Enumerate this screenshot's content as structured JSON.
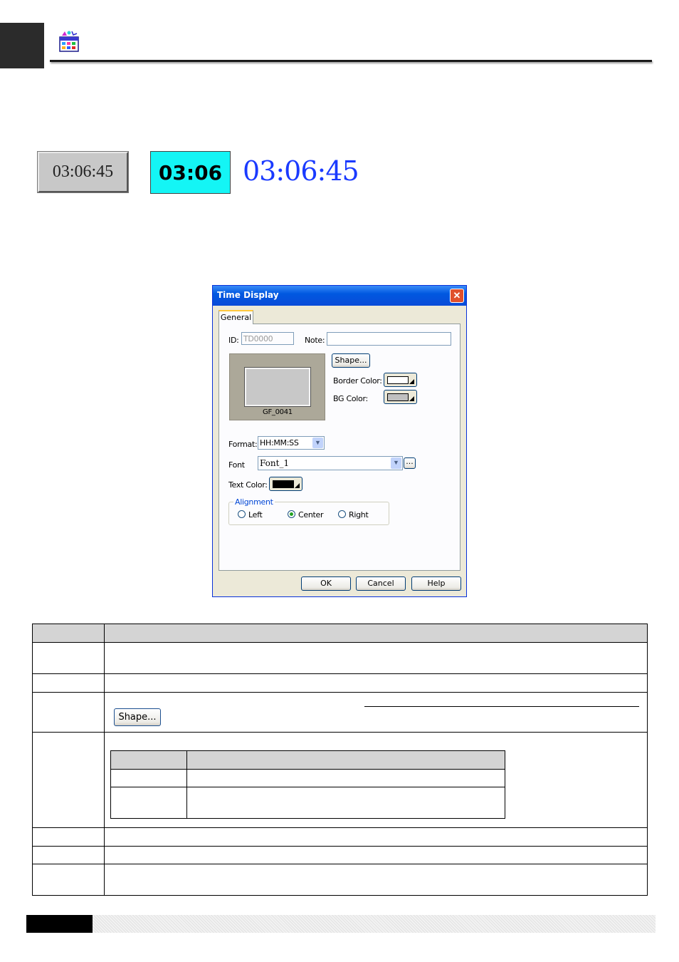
{
  "samples": {
    "sample1_text": "03:06:45",
    "sample2_text": "03:06",
    "sample3_text": "03:06:45"
  },
  "dialog": {
    "title": "Time Display",
    "close_glyph": "✕",
    "tab": "General",
    "id_label": "ID:",
    "id_value": "TD0000",
    "note_label": "Note:",
    "note_value": "",
    "shape_button": "Shape...",
    "shape_preview_name": "GF_0041",
    "border_color_label": "Border Color:",
    "bg_color_label": "BG Color:",
    "border_color": "#ffffff",
    "bg_color": "#c0c0c0",
    "format_label": "Format:",
    "format_value": "HH:MM:SS",
    "font_label": "Font",
    "font_value": "Font_1",
    "font_more_button": "...",
    "text_color_label": "Text Color:",
    "text_color": "#000000",
    "alignment_label": "Alignment",
    "align_left": "Left",
    "align_center": "Center",
    "align_right": "Right",
    "alignment_selected": "Center",
    "ok_button": "OK",
    "cancel_button": "Cancel",
    "help_button": "Help"
  },
  "table": {
    "shape_button": "Shape..."
  }
}
